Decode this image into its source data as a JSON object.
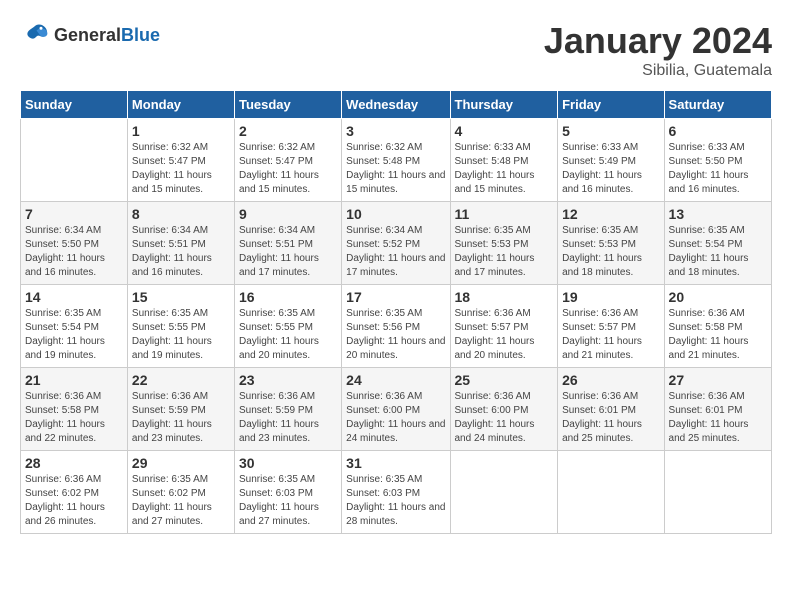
{
  "header": {
    "logo_general": "General",
    "logo_blue": "Blue",
    "month_title": "January 2024",
    "location": "Sibilia, Guatemala"
  },
  "days_of_week": [
    "Sunday",
    "Monday",
    "Tuesday",
    "Wednesday",
    "Thursday",
    "Friday",
    "Saturday"
  ],
  "weeks": [
    [
      {
        "day": "",
        "sunrise": "",
        "sunset": "",
        "daylight": ""
      },
      {
        "day": "1",
        "sunrise": "Sunrise: 6:32 AM",
        "sunset": "Sunset: 5:47 PM",
        "daylight": "Daylight: 11 hours and 15 minutes."
      },
      {
        "day": "2",
        "sunrise": "Sunrise: 6:32 AM",
        "sunset": "Sunset: 5:47 PM",
        "daylight": "Daylight: 11 hours and 15 minutes."
      },
      {
        "day": "3",
        "sunrise": "Sunrise: 6:32 AM",
        "sunset": "Sunset: 5:48 PM",
        "daylight": "Daylight: 11 hours and 15 minutes."
      },
      {
        "day": "4",
        "sunrise": "Sunrise: 6:33 AM",
        "sunset": "Sunset: 5:48 PM",
        "daylight": "Daylight: 11 hours and 15 minutes."
      },
      {
        "day": "5",
        "sunrise": "Sunrise: 6:33 AM",
        "sunset": "Sunset: 5:49 PM",
        "daylight": "Daylight: 11 hours and 16 minutes."
      },
      {
        "day": "6",
        "sunrise": "Sunrise: 6:33 AM",
        "sunset": "Sunset: 5:50 PM",
        "daylight": "Daylight: 11 hours and 16 minutes."
      }
    ],
    [
      {
        "day": "7",
        "sunrise": "Sunrise: 6:34 AM",
        "sunset": "Sunset: 5:50 PM",
        "daylight": "Daylight: 11 hours and 16 minutes."
      },
      {
        "day": "8",
        "sunrise": "Sunrise: 6:34 AM",
        "sunset": "Sunset: 5:51 PM",
        "daylight": "Daylight: 11 hours and 16 minutes."
      },
      {
        "day": "9",
        "sunrise": "Sunrise: 6:34 AM",
        "sunset": "Sunset: 5:51 PM",
        "daylight": "Daylight: 11 hours and 17 minutes."
      },
      {
        "day": "10",
        "sunrise": "Sunrise: 6:34 AM",
        "sunset": "Sunset: 5:52 PM",
        "daylight": "Daylight: 11 hours and 17 minutes."
      },
      {
        "day": "11",
        "sunrise": "Sunrise: 6:35 AM",
        "sunset": "Sunset: 5:53 PM",
        "daylight": "Daylight: 11 hours and 17 minutes."
      },
      {
        "day": "12",
        "sunrise": "Sunrise: 6:35 AM",
        "sunset": "Sunset: 5:53 PM",
        "daylight": "Daylight: 11 hours and 18 minutes."
      },
      {
        "day": "13",
        "sunrise": "Sunrise: 6:35 AM",
        "sunset": "Sunset: 5:54 PM",
        "daylight": "Daylight: 11 hours and 18 minutes."
      }
    ],
    [
      {
        "day": "14",
        "sunrise": "Sunrise: 6:35 AM",
        "sunset": "Sunset: 5:54 PM",
        "daylight": "Daylight: 11 hours and 19 minutes."
      },
      {
        "day": "15",
        "sunrise": "Sunrise: 6:35 AM",
        "sunset": "Sunset: 5:55 PM",
        "daylight": "Daylight: 11 hours and 19 minutes."
      },
      {
        "day": "16",
        "sunrise": "Sunrise: 6:35 AM",
        "sunset": "Sunset: 5:55 PM",
        "daylight": "Daylight: 11 hours and 20 minutes."
      },
      {
        "day": "17",
        "sunrise": "Sunrise: 6:35 AM",
        "sunset": "Sunset: 5:56 PM",
        "daylight": "Daylight: 11 hours and 20 minutes."
      },
      {
        "day": "18",
        "sunrise": "Sunrise: 6:36 AM",
        "sunset": "Sunset: 5:57 PM",
        "daylight": "Daylight: 11 hours and 20 minutes."
      },
      {
        "day": "19",
        "sunrise": "Sunrise: 6:36 AM",
        "sunset": "Sunset: 5:57 PM",
        "daylight": "Daylight: 11 hours and 21 minutes."
      },
      {
        "day": "20",
        "sunrise": "Sunrise: 6:36 AM",
        "sunset": "Sunset: 5:58 PM",
        "daylight": "Daylight: 11 hours and 21 minutes."
      }
    ],
    [
      {
        "day": "21",
        "sunrise": "Sunrise: 6:36 AM",
        "sunset": "Sunset: 5:58 PM",
        "daylight": "Daylight: 11 hours and 22 minutes."
      },
      {
        "day": "22",
        "sunrise": "Sunrise: 6:36 AM",
        "sunset": "Sunset: 5:59 PM",
        "daylight": "Daylight: 11 hours and 23 minutes."
      },
      {
        "day": "23",
        "sunrise": "Sunrise: 6:36 AM",
        "sunset": "Sunset: 5:59 PM",
        "daylight": "Daylight: 11 hours and 23 minutes."
      },
      {
        "day": "24",
        "sunrise": "Sunrise: 6:36 AM",
        "sunset": "Sunset: 6:00 PM",
        "daylight": "Daylight: 11 hours and 24 minutes."
      },
      {
        "day": "25",
        "sunrise": "Sunrise: 6:36 AM",
        "sunset": "Sunset: 6:00 PM",
        "daylight": "Daylight: 11 hours and 24 minutes."
      },
      {
        "day": "26",
        "sunrise": "Sunrise: 6:36 AM",
        "sunset": "Sunset: 6:01 PM",
        "daylight": "Daylight: 11 hours and 25 minutes."
      },
      {
        "day": "27",
        "sunrise": "Sunrise: 6:36 AM",
        "sunset": "Sunset: 6:01 PM",
        "daylight": "Daylight: 11 hours and 25 minutes."
      }
    ],
    [
      {
        "day": "28",
        "sunrise": "Sunrise: 6:36 AM",
        "sunset": "Sunset: 6:02 PM",
        "daylight": "Daylight: 11 hours and 26 minutes."
      },
      {
        "day": "29",
        "sunrise": "Sunrise: 6:35 AM",
        "sunset": "Sunset: 6:02 PM",
        "daylight": "Daylight: 11 hours and 27 minutes."
      },
      {
        "day": "30",
        "sunrise": "Sunrise: 6:35 AM",
        "sunset": "Sunset: 6:03 PM",
        "daylight": "Daylight: 11 hours and 27 minutes."
      },
      {
        "day": "31",
        "sunrise": "Sunrise: 6:35 AM",
        "sunset": "Sunset: 6:03 PM",
        "daylight": "Daylight: 11 hours and 28 minutes."
      },
      {
        "day": "",
        "sunrise": "",
        "sunset": "",
        "daylight": ""
      },
      {
        "day": "",
        "sunrise": "",
        "sunset": "",
        "daylight": ""
      },
      {
        "day": "",
        "sunrise": "",
        "sunset": "",
        "daylight": ""
      }
    ]
  ]
}
